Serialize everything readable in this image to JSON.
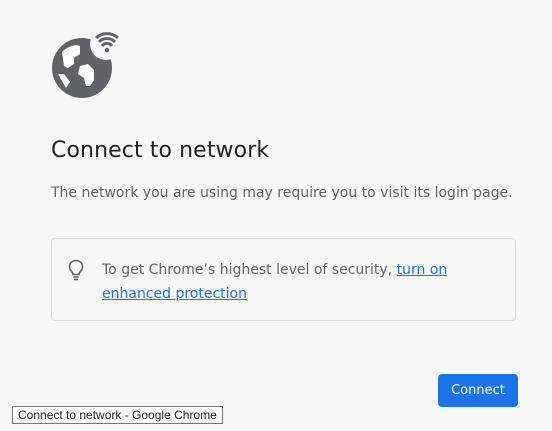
{
  "page": {
    "title": "Connect to network",
    "description": "The network you are using may require you to visit its login page.",
    "hero_icon": "globe-wifi-icon"
  },
  "info_box": {
    "icon": "lightbulb-icon",
    "text_before_link": "To get Chrome’s highest level of security, ",
    "link_text": "turn on enhanced protection"
  },
  "actions": {
    "connect_label": "Connect"
  },
  "tooltip": {
    "text": "Connect to network - Google Chrome"
  },
  "colors": {
    "accent": "#1a73e8",
    "icon_gray": "#5f6368",
    "background": "#f7f7f8"
  }
}
